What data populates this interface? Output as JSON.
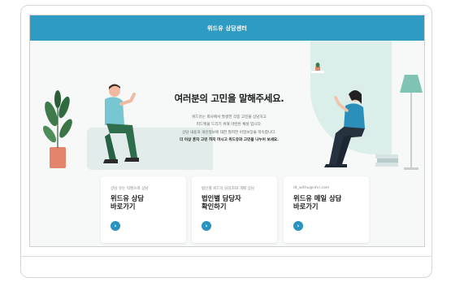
{
  "header": {
    "title": "위드유 상담센터"
  },
  "hero": {
    "headline": "여러분의 고민을 말해주세요.",
    "lines": [
      "위드유는 회사에서 발생한 각종 고민을 상담하고",
      "피드백을 드리기 위해 마련된 채널 입니다.",
      "상담 내용과 개인정보에 대한 철저한 비밀보장을 약속합니다."
    ],
    "emphasis": "더 이상 혼자 고민 하지 마시고 위드유와 고민을 나누어 보세요."
  },
  "cards": [
    {
      "subtitle": "상담 유는 익명으로 상담",
      "title_line1": "위드유 상담",
      "title_line2": "바로가기",
      "button": "›"
    },
    {
      "subtitle": "법인별 위드유 담당자와 개별 상담",
      "title_line1": "법인별 담당자",
      "title_line2": "확인하기",
      "button": "›"
    },
    {
      "subtitle": "dt_withu@nhn.com",
      "title_line1": "위드유 메일 상담",
      "title_line2": "바로가기",
      "button": "›"
    }
  ],
  "colors": {
    "header": "#2e9cc2",
    "accent_button": "#2a93bf",
    "hero_bg": "#f6f9f8",
    "mint": "#dbeeea"
  },
  "icons": [
    "chevron-right-icon",
    "plant-icon",
    "floor-lamp-icon"
  ]
}
